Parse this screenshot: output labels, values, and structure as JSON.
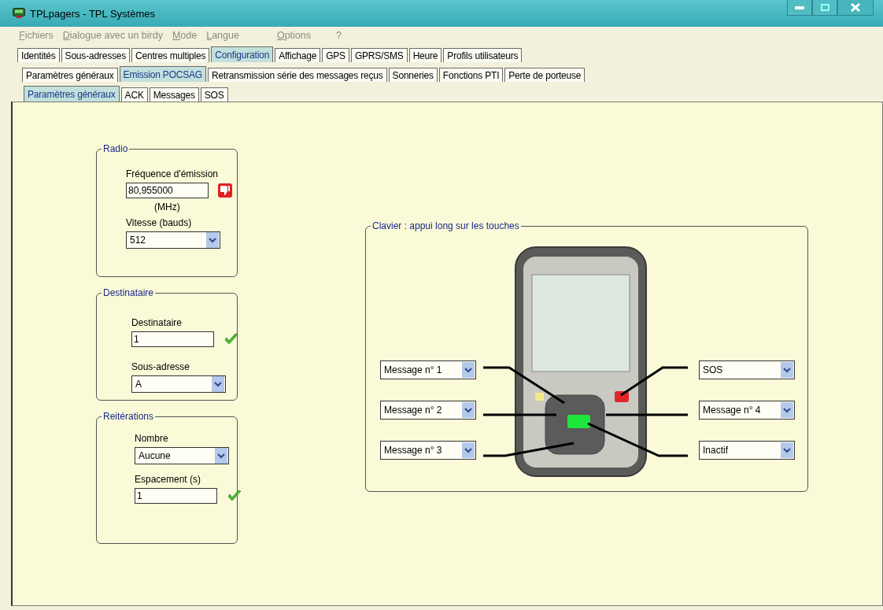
{
  "window": {
    "title": "TPLpagers - TPL Systèmes"
  },
  "menu": [
    {
      "label": "Fichiers",
      "disabled": true
    },
    {
      "label": "Dialogue avec un birdy",
      "disabled": true
    },
    {
      "label": "Mode",
      "disabled": true
    },
    {
      "label": "Langue",
      "disabled": true
    },
    {
      "label": "Options",
      "disabled": true
    },
    {
      "label": "?",
      "disabled": true
    }
  ],
  "tabs": [
    {
      "label": "Identités",
      "selected": false
    },
    {
      "label": "Sous-adresses",
      "selected": false
    },
    {
      "label": "Centres multiples",
      "selected": false
    },
    {
      "label": "Configuration",
      "selected": true
    },
    {
      "label": "Affichage",
      "selected": false
    },
    {
      "label": "GPS",
      "selected": false
    },
    {
      "label": "GPRS/SMS",
      "selected": false
    },
    {
      "label": "Heure",
      "selected": false
    },
    {
      "label": "Profils utilisateurs",
      "selected": false
    }
  ],
  "subtabs": [
    {
      "label": "Paramètres généraux",
      "selected": false
    },
    {
      "label": "Emission POCSAG",
      "selected": true
    },
    {
      "label": "Retransmission série des messages reçus",
      "selected": false
    },
    {
      "label": "Sonneries",
      "selected": false
    },
    {
      "label": "Fonctions PTI",
      "selected": false
    },
    {
      "label": "Perte de porteuse",
      "selected": false
    }
  ],
  "inner_tabs": [
    {
      "label": "Paramètres généraux",
      "selected": true
    },
    {
      "label": "ACK",
      "selected": false
    },
    {
      "label": "Messages",
      "selected": false
    },
    {
      "label": "SOS",
      "selected": false
    }
  ],
  "groups": [
    {
      "title": "Radio",
      "fields": [
        {
          "kind": "text",
          "label": "Fréquence d'émission",
          "value": "80,955000",
          "valid": false,
          "unit": "(MHz)"
        },
        {
          "kind": "dropdown",
          "label": "Vitesse (bauds)",
          "value": "512"
        }
      ]
    },
    {
      "title": "Destinataire",
      "fields": [
        {
          "kind": "text",
          "label": "Destinataire",
          "value": "1",
          "valid": true
        },
        {
          "kind": "dropdown",
          "label": "Sous-adresse",
          "value": "A"
        }
      ]
    },
    {
      "title": "Reitérations",
      "fields": [
        {
          "kind": "dropdown",
          "label": "Nombre",
          "value": "Aucune"
        },
        {
          "kind": "text",
          "label": "Espacement (s)",
          "value": "1",
          "valid": true
        }
      ]
    }
  ],
  "keypad": {
    "title": "Clavier : appui long sur les touches",
    "left": [
      "Message n° 1",
      "Message n° 2",
      "Message n° 3"
    ],
    "right": [
      "SOS",
      "Message n° 4",
      "Inactif"
    ]
  }
}
